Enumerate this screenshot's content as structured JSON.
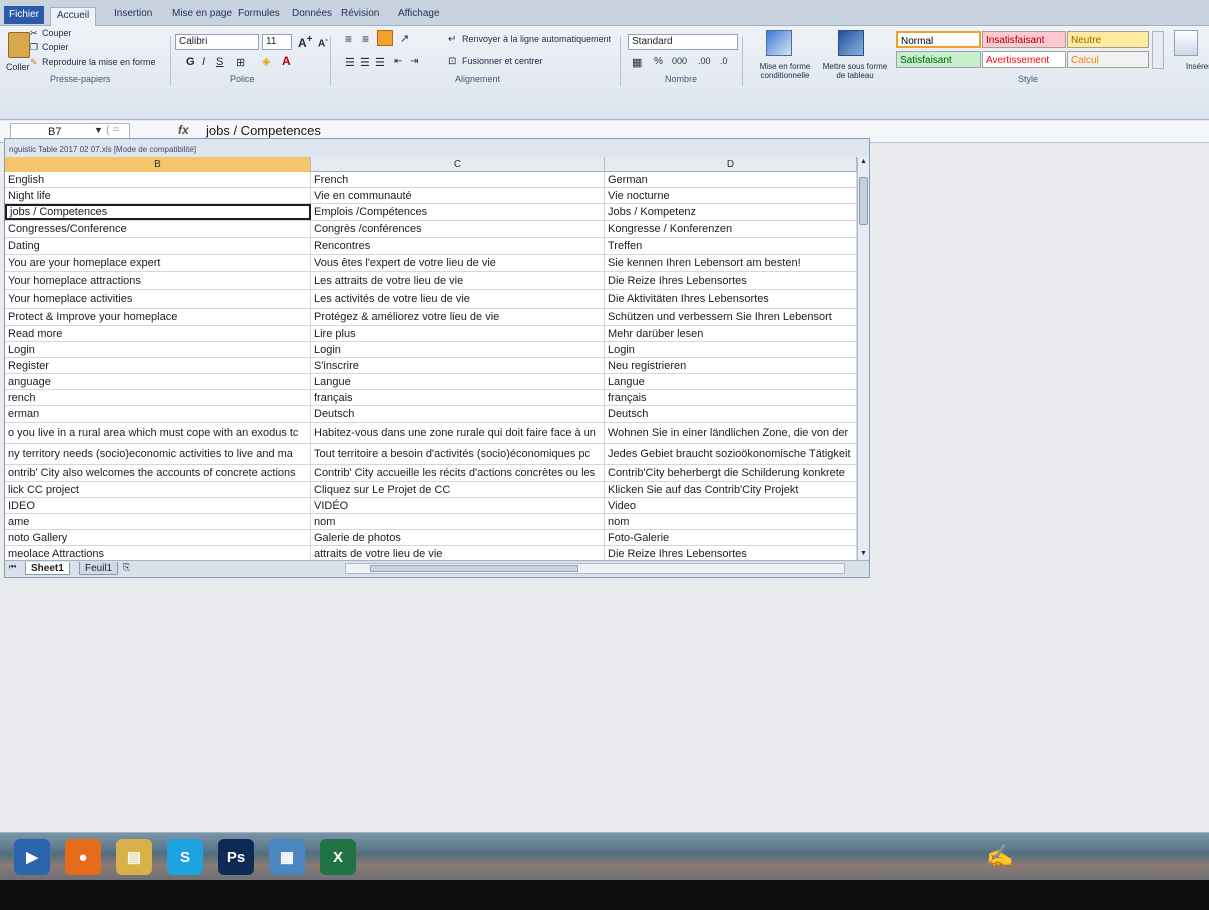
{
  "ribbon_tabs": [
    "Fichier",
    "Accueil",
    "Insertion",
    "Mise en page",
    "Formules",
    "Données",
    "Révision",
    "Affichage"
  ],
  "clipboard": {
    "paste": "Coller",
    "cut": "Couper",
    "copy": "Copier",
    "format_painter": "Reproduire la mise en forme",
    "group": "Presse-papiers"
  },
  "font": {
    "name": "Calibri",
    "size": "11",
    "group": "Police",
    "bold": "G",
    "italic": "I",
    "underline": "S"
  },
  "alignment": {
    "wrap": "Renvoyer à la ligne automatiquement",
    "merge": "Fusionner et centrer",
    "group": "Alignement"
  },
  "number": {
    "format": "Standard",
    "percent": "%",
    "thousands": "000",
    "group": "Nombre"
  },
  "styles_cmds": {
    "conditional": "Mise en forme conditionnelle",
    "as_table": "Mettre sous forme de tableau",
    "group": "Style"
  },
  "cell_styles": [
    {
      "label": "Normal",
      "bg": "#ffffff",
      "fg": "#000000"
    },
    {
      "label": "Insatisfaisant",
      "bg": "#ffc7ce",
      "fg": "#9c0006"
    },
    {
      "label": "Neutre",
      "bg": "#ffeb9c",
      "fg": "#9c6500"
    },
    {
      "label": "Satisfaisant",
      "bg": "#c6efce",
      "fg": "#006100"
    },
    {
      "label": "Avertissement",
      "bg": "#ffffff",
      "fg": "#ff0000"
    },
    {
      "label": "Calcul",
      "bg": "#f2f2f2",
      "fg": "#fa7d00"
    }
  ],
  "insert_label": "Insérer",
  "formula_bar": {
    "name_box": "B7",
    "fx": "fx",
    "value": "jobs / Competences"
  },
  "workbook": {
    "title": "nguistic Table 2017 02 07.xls [Mode de compatibilité]",
    "columns": [
      "B",
      "C",
      "D"
    ],
    "rows": [
      [
        "English",
        "French",
        "German"
      ],
      [
        "Night life",
        "Vie en communauté",
        "Vie nocturne"
      ],
      [
        "jobs / Competences",
        "Emplois /Compétences",
        "Jobs / Kompetenz"
      ],
      [
        "Congresses/Conference",
        "Congrès /conférences",
        "Kongresse / Konferenzen"
      ],
      [
        "Dating",
        "Rencontres",
        "Treffen"
      ],
      [
        "You are your homeplace expert",
        "Vous êtes l'expert de votre lieu de vie",
        "Sie kennen Ihren Lebensort am besten!"
      ],
      [
        "Your homeplace attractions",
        "Les attraits de votre lieu de vie",
        "Die Reize Ihres Lebensortes"
      ],
      [
        "Your homeplace activities",
        "Les activités de votre lieu de vie",
        "Die Aktivitäten Ihres Lebensortes"
      ],
      [
        "Protect & Improve your homeplace",
        "Protégez & améliorez votre lieu de vie",
        "Schützen und verbessern Sie Ihren Lebensort"
      ],
      [
        "Read more",
        "Lire plus",
        "Mehr darüber lesen"
      ],
      [
        "Login",
        "Login",
        "Login"
      ],
      [
        "Register",
        "S'inscrire",
        "Neu registrieren"
      ],
      [
        "anguage",
        "Langue",
        "Langue"
      ],
      [
        "rench",
        "français",
        "français"
      ],
      [
        "erman",
        "Deutsch",
        "Deutsch"
      ],
      [
        "o you live in a rural area which must cope with an exodus tc",
        "Habitez-vous dans une zone rurale qui doit faire face à un",
        "Wohnen Sie in einer ländlichen Zone, die von der"
      ],
      [
        "ny territory needs (socio)economic activities to live and ma",
        "Tout territoire a besoin d'activités (socio)économiques pc",
        "Jedes Gebiet braucht sozioökonomische Tätigkeit"
      ],
      [
        "ontrib' City also welcomes the accounts of concrete actions",
        "Contrib' City accueille les récits d'actions concrètes ou les",
        "Contrib'City beherbergt die Schilderung konkrete"
      ],
      [
        "lick CC project",
        "Cliquez sur Le Projet de CC",
        "Klicken Sie auf das Contrib'City Projekt"
      ],
      [
        "IDEO",
        "VIDÉO",
        "Video"
      ],
      [
        "ame",
        "nom",
        "nom"
      ],
      [
        "noto Gallery",
        "Galerie de photos",
        "Foto-Galerie"
      ],
      [
        "meolace Attractions",
        "attraits de votre lieu de vie",
        "Die Reize Ihres Lebensortes"
      ]
    ],
    "sheets": [
      "Sheet1",
      "Feuil1"
    ]
  },
  "taskbar": [
    {
      "name": "media-player-icon",
      "glyph": "▶",
      "color": "#2d64b0"
    },
    {
      "name": "firefox-icon",
      "glyph": "●",
      "color": "#e66a1a"
    },
    {
      "name": "explorer-folder-icon",
      "glyph": "▤",
      "color": "#d9b14a"
    },
    {
      "name": "skype-icon",
      "glyph": "S",
      "color": "#1da3e0"
    },
    {
      "name": "photoshop-icon",
      "glyph": "Ps",
      "color": "#0c2a55"
    },
    {
      "name": "network-icon",
      "glyph": "▦",
      "color": "#4a87c0"
    },
    {
      "name": "excel-icon",
      "glyph": "X",
      "color": "#217346"
    }
  ]
}
